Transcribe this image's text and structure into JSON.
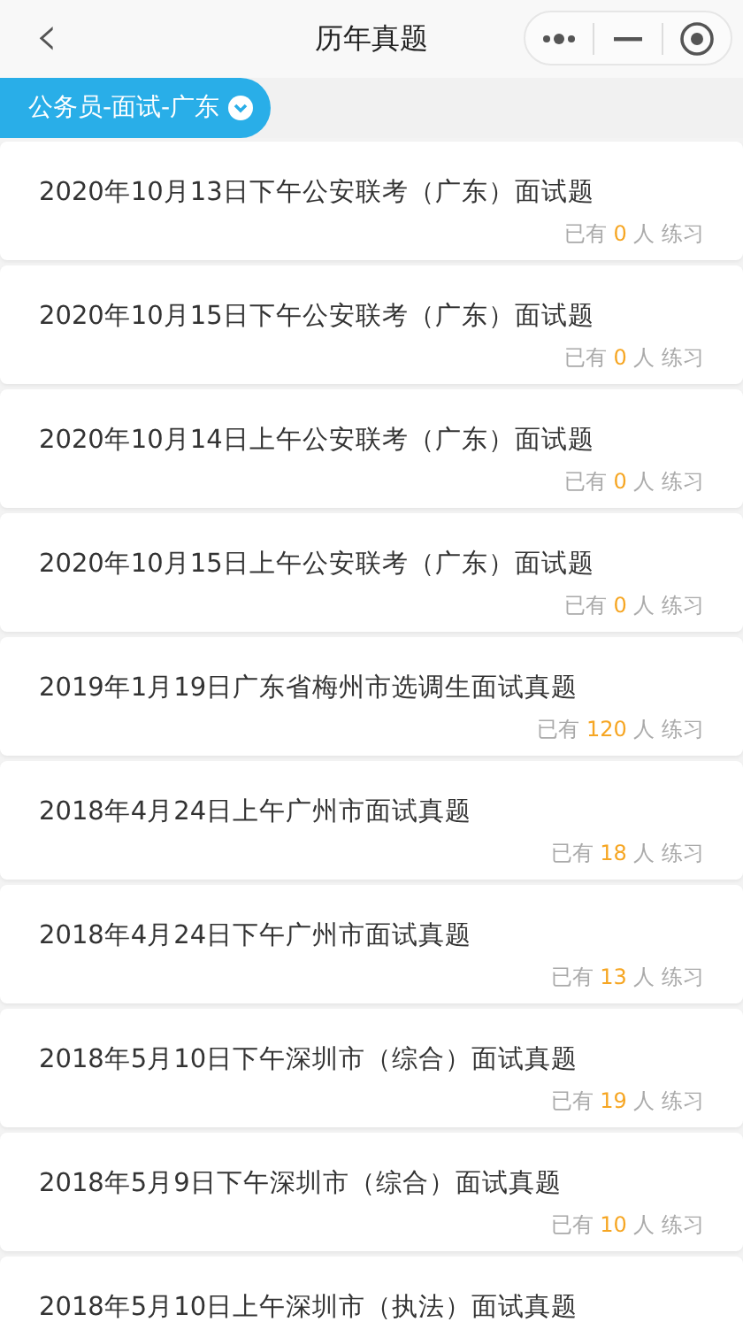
{
  "header": {
    "back": "‹",
    "title": "历年真题"
  },
  "filter": {
    "label": "公务员-面试-广东"
  },
  "exams": [
    {
      "title": "2020年10月13日下午公安联考（广东）面试题",
      "prefix": "已有",
      "count": "0",
      "suffix": "人 练习"
    },
    {
      "title": "2020年10月15日下午公安联考（广东）面试题",
      "prefix": "已有",
      "count": "0",
      "suffix": "人 练习"
    },
    {
      "title": "2020年10月14日上午公安联考（广东）面试题",
      "prefix": "已有",
      "count": "0",
      "suffix": "人 练习"
    },
    {
      "title": "2020年10月15日上午公安联考（广东）面试题",
      "prefix": "已有",
      "count": "0",
      "suffix": "人 练习"
    },
    {
      "title": "2019年1月19日广东省梅州市选调生面试真题",
      "prefix": "已有",
      "count": "120",
      "suffix": "人 练习"
    },
    {
      "title": "2018年4月24日上午广州市面试真题",
      "prefix": "已有",
      "count": "18",
      "suffix": "人 练习"
    },
    {
      "title": "2018年4月24日下午广州市面试真题",
      "prefix": "已有",
      "count": "13",
      "suffix": "人 练习"
    },
    {
      "title": "2018年5月10日下午深圳市（综合）面试真题",
      "prefix": "已有",
      "count": "19",
      "suffix": "人 练习"
    },
    {
      "title": "2018年5月9日下午深圳市（综合）面试真题",
      "prefix": "已有",
      "count": "10",
      "suffix": "人 练习"
    },
    {
      "title": "2018年5月10日上午深圳市（执法）面试真题"
    }
  ]
}
